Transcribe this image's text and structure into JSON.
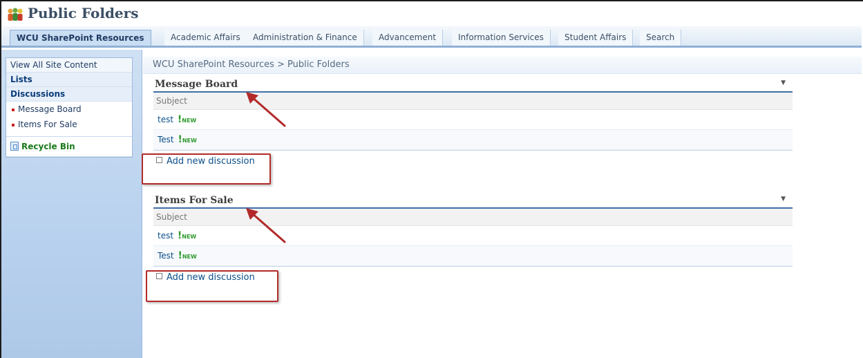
{
  "header": {
    "title": "Public Folders",
    "icon": "people-icon"
  },
  "tabs": [
    {
      "label": "WCU SharePoint Resources",
      "active": true
    },
    {
      "label": "Academic Affairs"
    },
    {
      "label": "Administration & Finance"
    },
    {
      "label": "Advancement"
    },
    {
      "label": "Information Services"
    },
    {
      "label": "Student Affairs"
    },
    {
      "label": "Search"
    }
  ],
  "sidebar": {
    "view_all": "View All Site Content",
    "lists": "Lists",
    "discussions": "Discussions",
    "items": [
      "Message Board",
      "Items For Sale"
    ],
    "recycle_bin": "Recycle Bin"
  },
  "breadcrumb": "WCU SharePoint Resources > Public Folders",
  "webparts": [
    {
      "title": "Message Board",
      "column": "Subject",
      "rows": [
        {
          "subject": "test",
          "new": "NEW"
        },
        {
          "subject": "Test",
          "new": "NEW"
        }
      ],
      "add_label": "Add new discussion"
    },
    {
      "title": "Items For Sale",
      "column": "Subject",
      "rows": [
        {
          "subject": "test",
          "new": "NEW"
        },
        {
          "subject": "Test",
          "new": "NEW"
        }
      ],
      "add_label": "Add new discussion"
    }
  ],
  "colors": {
    "accent": "#3f6fa8",
    "callout": "#b22a2a",
    "new_badge": "#2e9a2e"
  }
}
